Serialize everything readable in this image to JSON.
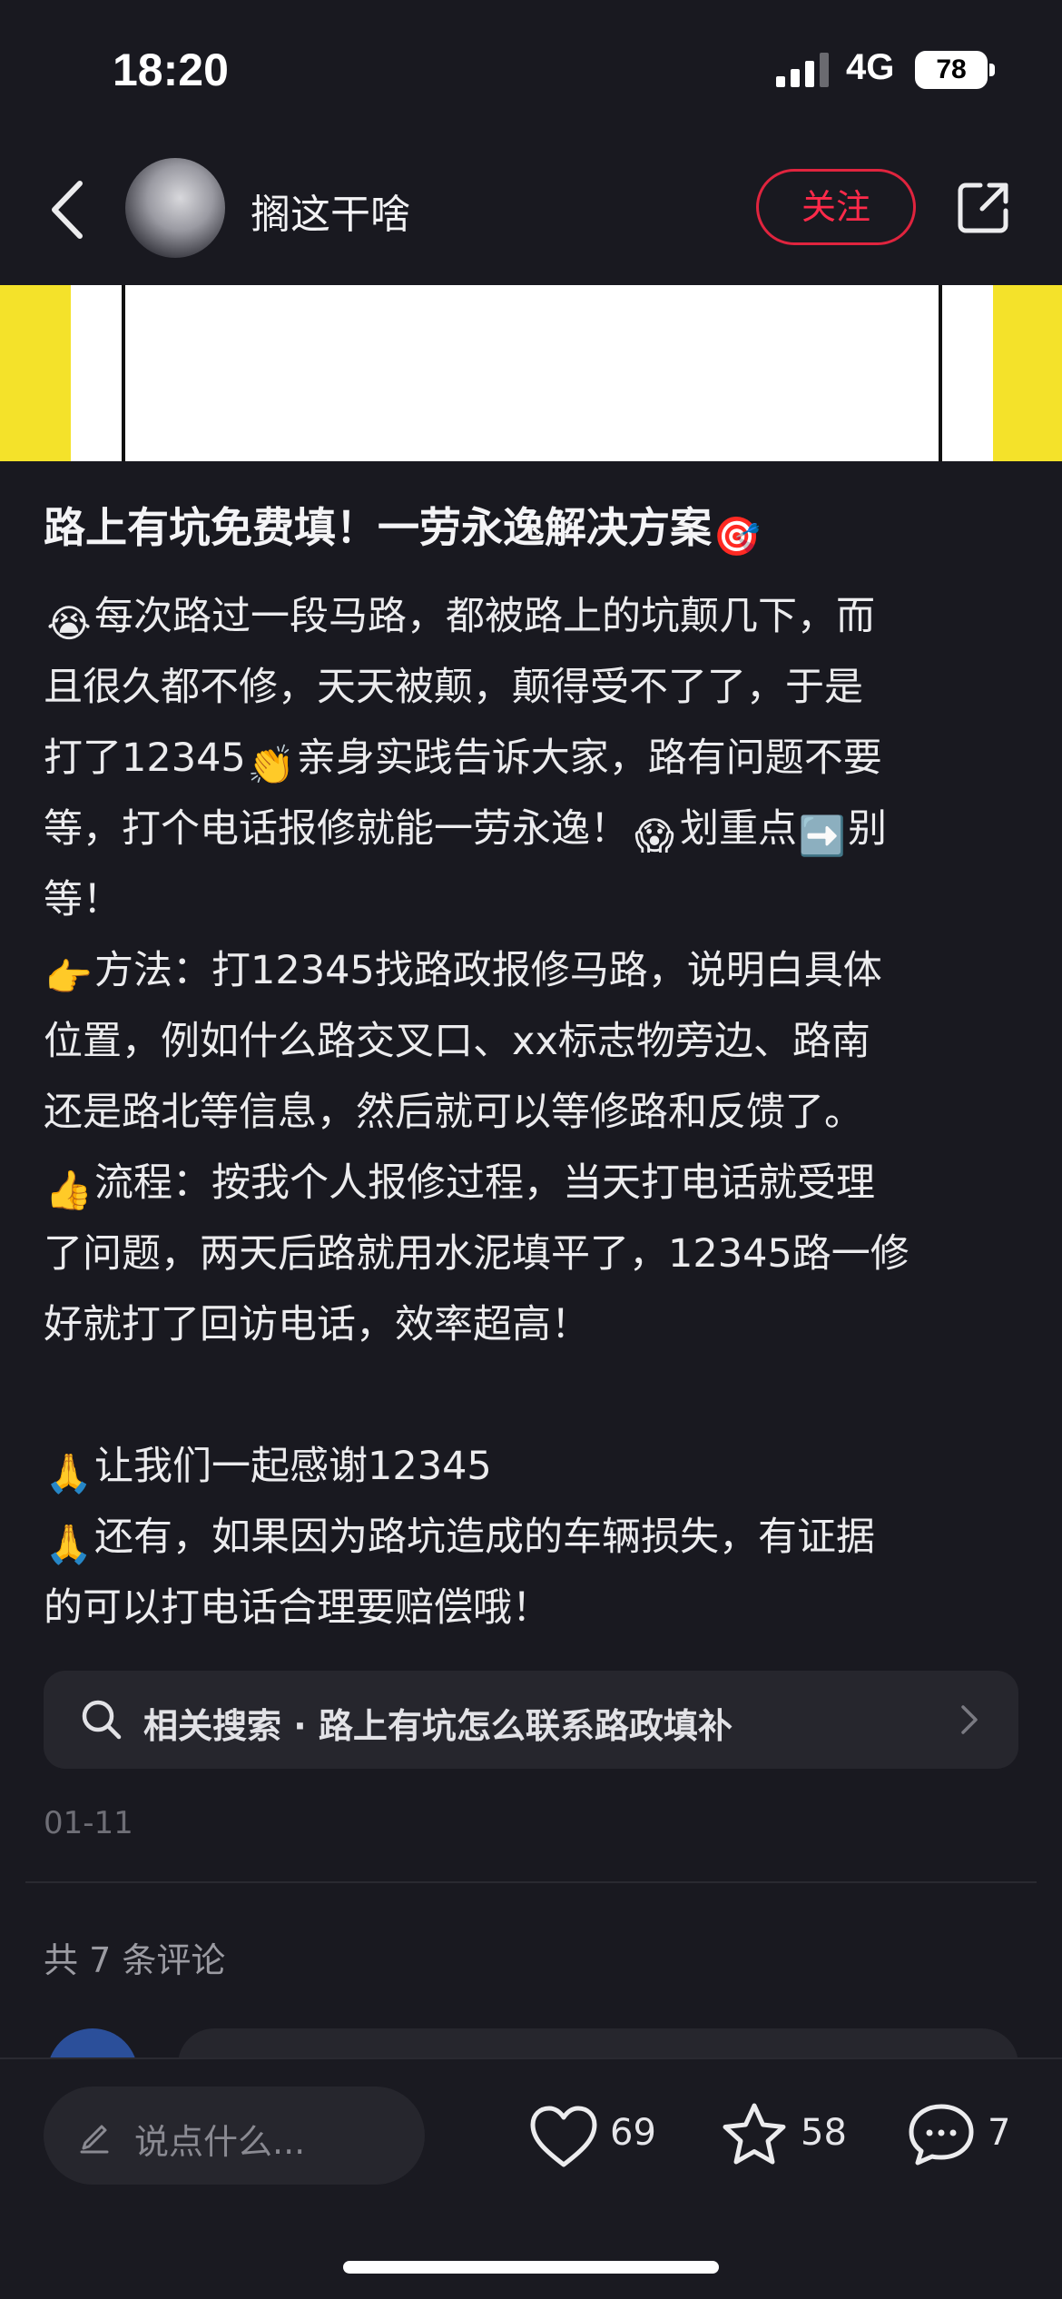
{
  "status_bar": {
    "time": "18:20",
    "network": "4G",
    "battery": "78"
  },
  "header": {
    "author": "搁这干啥",
    "follow_label": "关注"
  },
  "post": {
    "title": "路上有坑免费填！一劳永逸解决方案",
    "title_emoji": "🎯",
    "lines": [
      {
        "emoji": "😭",
        "text": "每次路过一段马路，都被路上的坑颠几下，而"
      },
      {
        "text": "且很久都不修，天天被颠，颠得受不了了，于是"
      },
      {
        "text": "打了12345",
        "emoji2": "👏",
        "text2": "亲身实践告诉大家，路有问题不要"
      },
      {
        "text": "等，打个电话报修就能一劳永逸！",
        "emoji2": "😱",
        "text2": "划重点",
        "emoji3": "➡️",
        "text3": "别"
      },
      {
        "text": "等！"
      },
      {
        "emoji": "👉",
        "text": "方法：打12345找路政报修马路，说明白具体"
      },
      {
        "text": "位置，例如什么路交叉口、xx标志物旁边、路南"
      },
      {
        "text": "还是路北等信息，然后就可以等修路和反馈了。"
      },
      {
        "emoji": "👍",
        "text": "流程：按我个人报修过程，当天打电话就受理"
      },
      {
        "text": "了问题，两天后路就用水泥填平了，12345路一修"
      },
      {
        "text": "好就打了回访电话，效率超高！"
      },
      {
        "text": ""
      },
      {
        "emoji": "🙏",
        "text": "让我们一起感谢12345"
      },
      {
        "emoji": "🙏",
        "text": "还有，如果因为路坑造成的车辆损失，有证据"
      },
      {
        "text": "的可以打电话合理要赔偿哦！"
      }
    ],
    "related_search": "相关搜索 · 路上有坑怎么联系路政填补",
    "date": "01-11",
    "comment_count_label": "共 7 条评论"
  },
  "bottom_bar": {
    "input_placeholder": "说点什么...",
    "likes": "69",
    "favorites": "58",
    "comments": "7"
  },
  "colors": {
    "background": "#191920",
    "accent_red": "#ff2a4a",
    "image_yellow": "#f4e22a"
  }
}
